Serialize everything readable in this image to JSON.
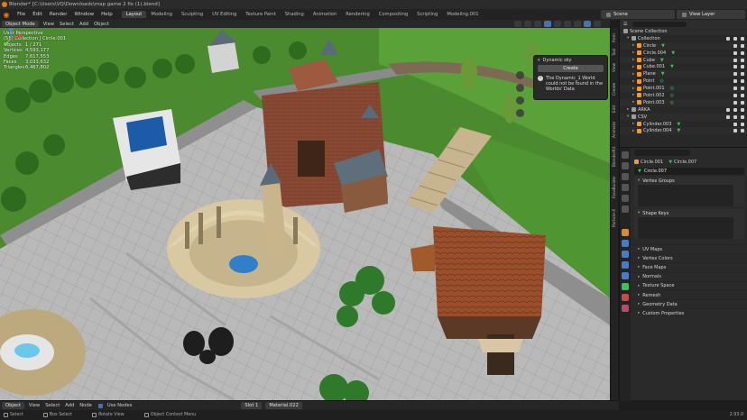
{
  "window": {
    "title": "Blender* [C:\\Users\\VQ\\Downloads\\map game 2 fix (1).blend]"
  },
  "menubar": {
    "items": [
      "File",
      "Edit",
      "Render",
      "Window",
      "Help"
    ],
    "tabs": [
      "Layout",
      "Modeling",
      "Sculpting",
      "UV Editing",
      "Texture Paint",
      "Shading",
      "Animation",
      "Rendering",
      "Compositing",
      "Scripting",
      "Modeling.001"
    ],
    "active_tab": "Layout",
    "scene": "Scene",
    "view_layer": "View Layer"
  },
  "viewport_header": {
    "mode": "Object Mode",
    "items": [
      "View",
      "Select",
      "Add",
      "Object"
    ]
  },
  "viewport_overlay": {
    "view_name": "User Perspective",
    "collection": "(58) Collection | Circle.001",
    "stats": [
      {
        "label": "Objects",
        "value": "1 / 271"
      },
      {
        "label": "Vertices",
        "value": "4,593,177"
      },
      {
        "label": "Edges",
        "value": "7,617,553"
      },
      {
        "label": "Faces",
        "value": "3,033,632"
      },
      {
        "label": "Triangles",
        "value": "6,467,802"
      }
    ]
  },
  "dynamic_sky_popup": {
    "title": "Dynamic sky",
    "button": "Create",
    "message": "The Dynamic_1 World could not be found in the Worlds' Data"
  },
  "side_tabs": [
    "Item",
    "Tool",
    "View",
    "Create",
    "Edit",
    "Animate",
    "BlenderKit",
    "FaceBuilder",
    "Particle-X"
  ],
  "outliner": {
    "root": "Scene Collection",
    "rows": [
      {
        "name": "Collection",
        "kind": "collection",
        "depth": 0
      },
      {
        "name": "Circle",
        "kind": "mesh",
        "depth": 1
      },
      {
        "name": "Circle.004",
        "kind": "mesh",
        "depth": 1
      },
      {
        "name": "Cube",
        "kind": "mesh",
        "depth": 1
      },
      {
        "name": "Cube.001",
        "kind": "mesh",
        "depth": 1
      },
      {
        "name": "Plane",
        "kind": "mesh",
        "depth": 1
      },
      {
        "name": "Point",
        "kind": "light",
        "depth": 1
      },
      {
        "name": "Point.001",
        "kind": "light",
        "depth": 1
      },
      {
        "name": "Point.002",
        "kind": "light",
        "depth": 1
      },
      {
        "name": "Point.003",
        "kind": "light",
        "depth": 1
      },
      {
        "name": "ARKA",
        "kind": "collection",
        "depth": 0
      },
      {
        "name": "CSV",
        "kind": "collection",
        "depth": 0
      },
      {
        "name": "Cylinder.003",
        "kind": "mesh",
        "depth": 1
      },
      {
        "name": "Cylinder.004",
        "kind": "mesh",
        "depth": 1
      }
    ]
  },
  "properties": {
    "breadcrumb": [
      "Circle.001",
      "Circle.007"
    ],
    "mesh_name": "Circle.007",
    "panels": [
      "Vertex Groups",
      "Shape Keys"
    ],
    "sections": [
      "UV Maps",
      "Vertex Colors",
      "Face Maps",
      "Normals",
      "Texture Space",
      "Remesh",
      "Geometry Data",
      "Custom Properties"
    ]
  },
  "shader_header": {
    "mode": "Object",
    "items": [
      "View",
      "Select",
      "Add",
      "Node"
    ],
    "use_nodes": "Use Nodes",
    "slot": "Slot 1",
    "material": "Material.022"
  },
  "statusbar": {
    "items": [
      "Select",
      "Box Select",
      "Rotate View",
      "Object Context Menu"
    ],
    "version": "2.93.0"
  },
  "colors": {
    "accent": "#4772b3",
    "orange": "#e87d0d",
    "mesh_triangle": "#3fbf5a"
  }
}
